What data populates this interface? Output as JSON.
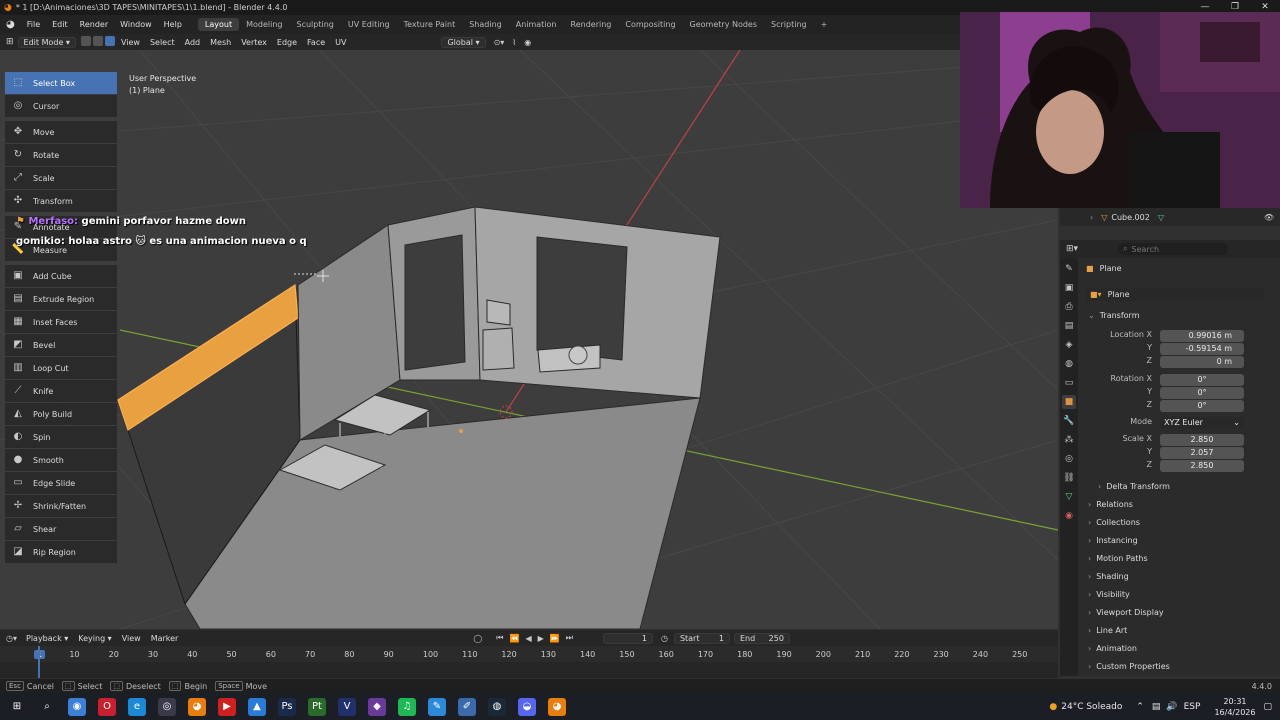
{
  "window": {
    "title": "* 1 [D:\\Animaciones\\3D TAPES\\MINITAPES\\1\\1.blend] - Blender 4.4.0",
    "controls": [
      "—",
      "❐",
      "✕"
    ]
  },
  "menubar": {
    "menus": [
      "File",
      "Edit",
      "Render",
      "Window",
      "Help"
    ],
    "workspaces": [
      "Layout",
      "Modeling",
      "Sculpting",
      "UV Editing",
      "Texture Paint",
      "Shading",
      "Animation",
      "Rendering",
      "Compositing",
      "Geometry Nodes",
      "Scripting"
    ],
    "active_workspace": "Layout",
    "add_tab": "+"
  },
  "viewport_header": {
    "mode": "Edit Mode",
    "menus": [
      "View",
      "Select",
      "Add",
      "Mesh",
      "Vertex",
      "Edge",
      "Face",
      "UV"
    ],
    "orientation": "Global"
  },
  "viewport": {
    "perspective_label": "User Perspective",
    "object_label": "(1) Plane",
    "grid_color": "#474747",
    "x_axis_color": "#c0404a",
    "y_axis_color": "#7aa331",
    "selected_face_color": "#e8a040"
  },
  "toolbar": {
    "tools": [
      {
        "label": "Select Box",
        "icon": "select-box-icon",
        "glyph": "⬚",
        "active": true
      },
      {
        "label": "Cursor",
        "icon": "cursor-icon",
        "glyph": "◎"
      },
      {
        "label": "Move",
        "icon": "move-icon",
        "glyph": "✥"
      },
      {
        "label": "Rotate",
        "icon": "rotate-icon",
        "glyph": "↻"
      },
      {
        "label": "Scale",
        "icon": "scale-icon",
        "glyph": "⤢"
      },
      {
        "label": "Transform",
        "icon": "transform-icon",
        "glyph": "✣"
      },
      {
        "label": "Annotate",
        "icon": "annotate-icon",
        "glyph": "✎"
      },
      {
        "label": "Measure",
        "icon": "measure-icon",
        "glyph": "📏"
      },
      {
        "label": "Add Cube",
        "icon": "add-cube-icon",
        "glyph": "▣"
      },
      {
        "label": "Extrude Region",
        "icon": "extrude-region-icon",
        "glyph": "▤"
      },
      {
        "label": "Inset Faces",
        "icon": "inset-faces-icon",
        "glyph": "▦"
      },
      {
        "label": "Bevel",
        "icon": "bevel-icon",
        "glyph": "◩"
      },
      {
        "label": "Loop Cut",
        "icon": "loop-cut-icon",
        "glyph": "▥"
      },
      {
        "label": "Knife",
        "icon": "knife-icon",
        "glyph": "⟋"
      },
      {
        "label": "Poly Build",
        "icon": "poly-build-icon",
        "glyph": "◭"
      },
      {
        "label": "Spin",
        "icon": "spin-icon",
        "glyph": "◐"
      },
      {
        "label": "Smooth",
        "icon": "smooth-icon",
        "glyph": "●"
      },
      {
        "label": "Edge Slide",
        "icon": "edge-slide-icon",
        "glyph": "▭"
      },
      {
        "label": "Shrink/Fatten",
        "icon": "shrink-fatten-icon",
        "glyph": "✢"
      },
      {
        "label": "Shear",
        "icon": "shear-icon",
        "glyph": "▱"
      },
      {
        "label": "Rip Region",
        "icon": "rip-region-icon",
        "glyph": "◪"
      }
    ]
  },
  "chat": [
    {
      "user": "Merfaso:",
      "message": "gemini porfavor hazme down"
    },
    {
      "user": "gomikio:",
      "message": "holaa astro 🐱 es una animacion nueva o q"
    }
  ],
  "outliner": {
    "visible_item": "Cube.002"
  },
  "properties": {
    "search_placeholder": "Search",
    "object_name_header": "Plane",
    "object_name_field": "Plane",
    "transform_panel": "Transform",
    "location": {
      "label": "Location X",
      "x": "0.99016 m",
      "y": "-0.59154 m",
      "z": "0 m"
    },
    "rotation": {
      "label": "Rotation X",
      "x": "0°",
      "y": "0°",
      "z": "0°"
    },
    "rotation_mode": {
      "label": "Mode",
      "value": "XYZ Euler"
    },
    "scale": {
      "label": "Scale X",
      "x": "2.850",
      "y": "2.057",
      "z": "2.850"
    },
    "axis_labels": {
      "y": "Y",
      "z": "Z"
    },
    "delta_transform": "Delta Transform",
    "panels": [
      "Relations",
      "Collections",
      "Instancing",
      "Motion Paths",
      "Shading",
      "Visibility",
      "Viewport Display",
      "Line Art",
      "Animation",
      "Custom Properties"
    ]
  },
  "timeline": {
    "menus": [
      "Playback",
      "Keying",
      "View",
      "Marker"
    ],
    "current_frame": "1",
    "start_label": "Start",
    "start": "1",
    "end_label": "End",
    "end": "250",
    "ticks": [
      "1",
      "10",
      "20",
      "30",
      "40",
      "50",
      "60",
      "70",
      "80",
      "90",
      "100",
      "110",
      "120",
      "130",
      "140",
      "150",
      "160",
      "170",
      "180",
      "190",
      "200",
      "210",
      "220",
      "230",
      "240",
      "250"
    ]
  },
  "statusbar": {
    "items": [
      {
        "key": "Esc",
        "label": "Cancel"
      },
      {
        "key": "⬚",
        "label": "Select"
      },
      {
        "key": "⬚",
        "label": "Deselect"
      },
      {
        "key": "⬚",
        "label": "Begin"
      },
      {
        "key": "Space",
        "label": "Move"
      }
    ],
    "version": "4.4.0"
  },
  "taskbar": {
    "weather": "24°C  Soleado",
    "language": "ESP",
    "time": "20:31",
    "date": "16/4/2026",
    "apps": [
      {
        "name": "windows-start-icon",
        "glyph": "⊞",
        "color": "#1c1e26"
      },
      {
        "name": "search-icon",
        "glyph": "⌕",
        "color": "#1c1e26"
      },
      {
        "name": "chrome-icon",
        "glyph": "◉",
        "color": "#3b7fd8"
      },
      {
        "name": "opera-icon",
        "glyph": "O",
        "color": "#c8202e"
      },
      {
        "name": "edge-icon",
        "glyph": "e",
        "color": "#1a8ad8"
      },
      {
        "name": "obs-icon",
        "glyph": "◎",
        "color": "#3a3a4a"
      },
      {
        "name": "blender-app-icon",
        "glyph": "◕",
        "color": "#e87d0d"
      },
      {
        "name": "video-app-icon",
        "glyph": "▶",
        "color": "#d02020"
      },
      {
        "name": "photos-icon",
        "glyph": "▲",
        "color": "#2a7ad8"
      },
      {
        "name": "photoshop-icon",
        "glyph": "Ps",
        "color": "#1a2a4a"
      },
      {
        "name": "pt-icon",
        "glyph": "Pt",
        "color": "#2a6a2a"
      },
      {
        "name": "vegas-icon",
        "glyph": "V",
        "color": "#20306a"
      },
      {
        "name": "app-icon",
        "glyph": "◆",
        "color": "#6a3a9a"
      },
      {
        "name": "spotify-icon",
        "glyph": "♫",
        "color": "#1db954"
      },
      {
        "name": "notepad-icon",
        "glyph": "✎",
        "color": "#2a8ad8"
      },
      {
        "name": "pen-app-icon",
        "glyph": "✐",
        "color": "#3a6aaa"
      },
      {
        "name": "steam-icon",
        "glyph": "◍",
        "color": "#1b2838"
      },
      {
        "name": "discord-icon",
        "glyph": "◒",
        "color": "#5865f2"
      },
      {
        "name": "blender-running-icon",
        "glyph": "◕",
        "color": "#e87d0d"
      }
    ]
  }
}
